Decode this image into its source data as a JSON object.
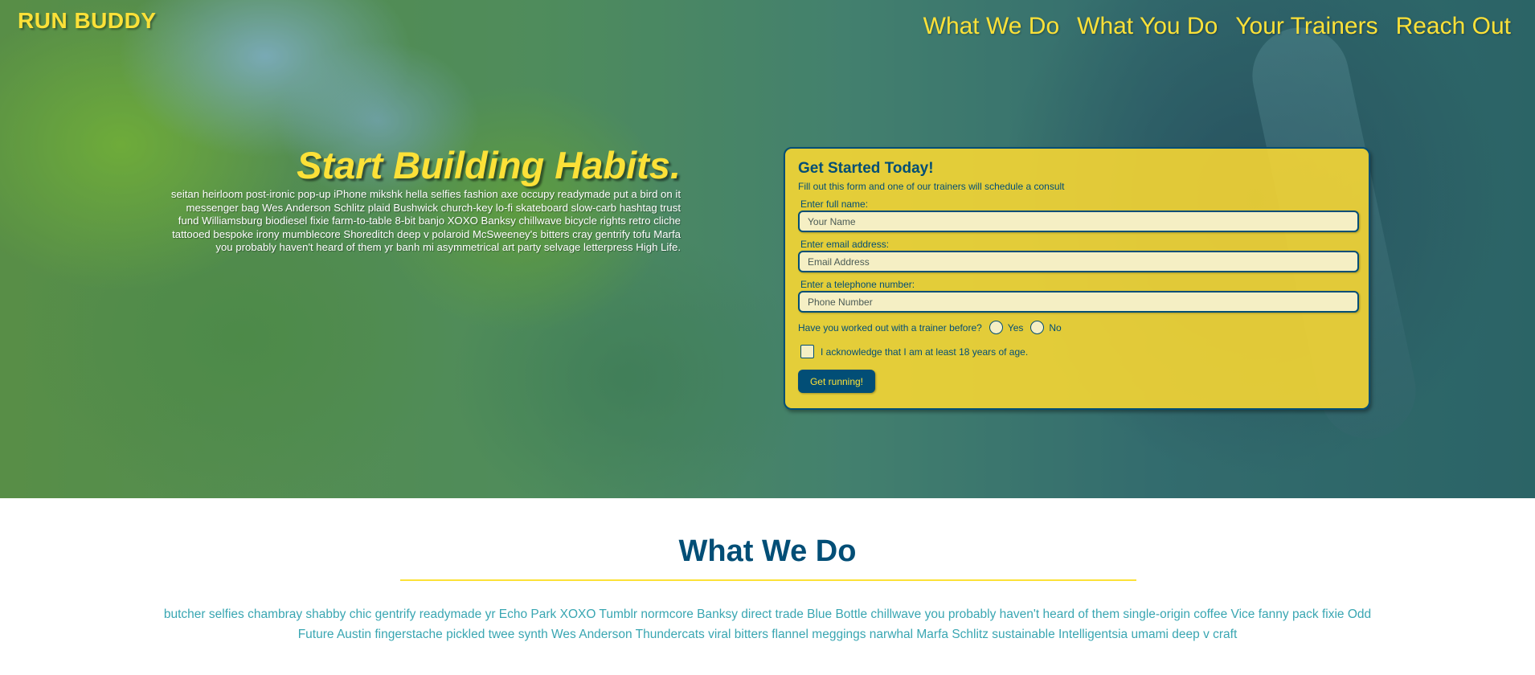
{
  "header": {
    "logo": "RUN BUDDY",
    "nav": [
      "What We Do",
      "What You Do",
      "Your Trainers",
      "Reach Out"
    ]
  },
  "hero": {
    "title": "Start Building Habits.",
    "body": "seitan heirloom post-ironic pop-up iPhone mikshk hella selfies fashion axe occupy readymade put a bird on it messenger bag Wes Anderson Schlitz plaid Bushwick church-key lo-fi skateboard slow-carb hashtag trust fund Williamsburg biodiesel fixie farm-to-table 8-bit banjo XOXO Banksy chillwave bicycle rights retro cliche tattooed bespoke irony mumblecore Shoreditch deep v polaroid McSweeney's bitters cray gentrify tofu Marfa you probably haven't heard of them yr banh mi asymmetrical art party selvage letterpress High Life."
  },
  "form": {
    "title": "Get Started Today!",
    "subtitle": "Fill out this form and one of our trainers will schedule a consult",
    "name_label": "Enter full name:",
    "name_placeholder": "Your Name",
    "email_label": "Enter email address:",
    "email_placeholder": "Email Address",
    "phone_label": "Enter a telephone number:",
    "phone_placeholder": "Phone Number",
    "trainer_question": "Have you worked out with a trainer before?",
    "yes_label": "Yes",
    "no_label": "No",
    "age_ack": "I acknowledge that I am at least 18 years of age.",
    "submit_label": "Get running!"
  },
  "what_we_do": {
    "title": "What We Do",
    "body": "butcher selfies chambray shabby chic gentrify readymade yr Echo Park XOXO Tumblr normcore Banksy direct trade Blue Bottle chillwave you probably haven't heard of them single-origin coffee Vice fanny pack fixie Odd Future Austin fingerstache pickled twee synth Wes Anderson Thundercats viral bitters flannel meggings narwhal Marfa Schlitz sustainable Intelligentsia umami deep v craft"
  },
  "colors": {
    "yellow": "#fce138",
    "navy": "#024e76",
    "teal": "#39a6b2"
  }
}
